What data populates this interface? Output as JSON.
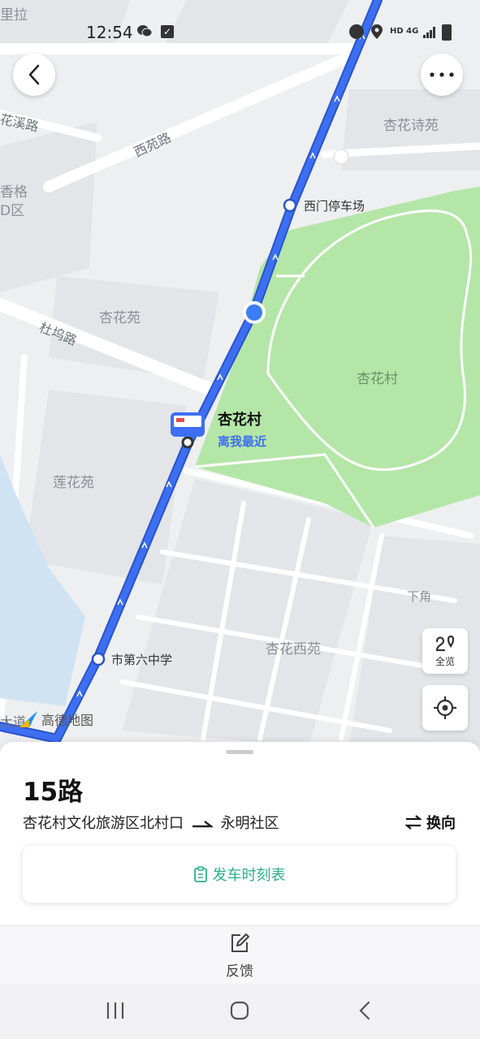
{
  "status_bar": {
    "time": "12:54",
    "right_text": "HD 4G"
  },
  "map": {
    "area_labels": [
      "杏花诗苑",
      "杏花苑",
      "杏花村",
      "莲花苑",
      "下角",
      "杏花西苑",
      "香格",
      "D区",
      "里拉"
    ],
    "road_labels": [
      "西苑路",
      "杜坞路",
      "花溪路",
      "大道"
    ],
    "stops": [
      "西门停车场",
      "市第六中学"
    ],
    "nearest_stop": {
      "name": "杏花村",
      "tag": "离我最近"
    },
    "logo_text": "高德地图",
    "route_color": "#3d6ff2",
    "park_color": "#b4e6a8"
  },
  "buttons": {
    "overview": "全览"
  },
  "sheet": {
    "route_name": "15路",
    "from": "杏花村文化旅游区北村口",
    "to": "永明社区",
    "switch_label": "换向",
    "timetable_label": "发车时刻表"
  },
  "feedback": {
    "label": "反馈"
  }
}
